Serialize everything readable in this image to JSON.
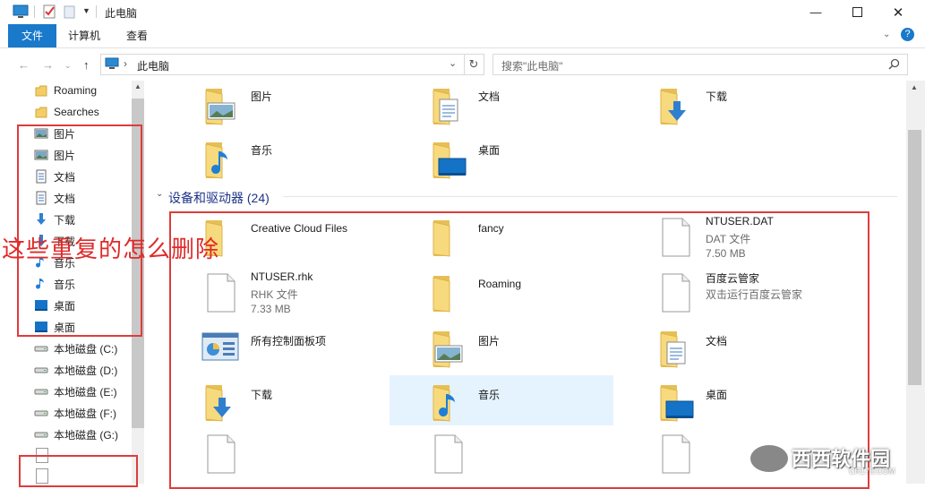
{
  "window": {
    "title": "此电脑"
  },
  "ribbon": {
    "tabs": [
      "文件",
      "计算机",
      "查看"
    ]
  },
  "address": {
    "path": "此电脑",
    "search_placeholder": "搜索\"此电脑\""
  },
  "sidebar": {
    "items": [
      {
        "label": "Roaming",
        "icon": "folder-icon"
      },
      {
        "label": "Searches",
        "icon": "folder-icon"
      },
      {
        "label": "图片",
        "icon": "pictures-icon"
      },
      {
        "label": "图片",
        "icon": "pictures-icon"
      },
      {
        "label": "文档",
        "icon": "documents-icon"
      },
      {
        "label": "文档",
        "icon": "documents-icon"
      },
      {
        "label": "下载",
        "icon": "downloads-icon"
      },
      {
        "label": "下载",
        "icon": "downloads-icon"
      },
      {
        "label": "音乐",
        "icon": "music-icon"
      },
      {
        "label": "音乐",
        "icon": "music-icon"
      },
      {
        "label": "桌面",
        "icon": "desktop-icon"
      },
      {
        "label": "桌面",
        "icon": "desktop-icon"
      },
      {
        "label": "本地磁盘 (C:)",
        "icon": "drive-icon"
      },
      {
        "label": "本地磁盘 (D:)",
        "icon": "drive-icon"
      },
      {
        "label": "本地磁盘 (E:)",
        "icon": "drive-icon"
      },
      {
        "label": "本地磁盘 (F:)",
        "icon": "drive-icon"
      },
      {
        "label": "本地磁盘 (G:)",
        "icon": "drive-icon"
      }
    ]
  },
  "folders_top": [
    {
      "name": "图片",
      "icon": "pictures-icon"
    },
    {
      "name": "文档",
      "icon": "documents-icon"
    },
    {
      "name": "下载",
      "icon": "downloads-icon"
    },
    {
      "name": "音乐",
      "icon": "music-icon"
    },
    {
      "name": "桌面",
      "icon": "desktop-icon"
    }
  ],
  "devices": {
    "header": "设备和驱动器 (24)",
    "items": [
      {
        "name": "Creative Cloud Files",
        "icon": "folder-icon"
      },
      {
        "name": "fancy",
        "icon": "folder-icon"
      },
      {
        "name": "NTUSER.DAT",
        "type": "DAT 文件",
        "size": "7.50 MB",
        "icon": "file-icon"
      },
      {
        "name": "NTUSER.rhk",
        "type": "RHK 文件",
        "size": "7.33 MB",
        "icon": "file-icon"
      },
      {
        "name": "Roaming",
        "icon": "folder-icon"
      },
      {
        "name": "百度云管家",
        "type": "双击运行百度云管家",
        "icon": "file-icon"
      },
      {
        "name": "所有控制面板项",
        "icon": "control-panel-icon"
      },
      {
        "name": "图片",
        "icon": "pictures-icon"
      },
      {
        "name": "文档",
        "icon": "documents-icon"
      },
      {
        "name": "下载",
        "icon": "downloads-icon"
      },
      {
        "name": "音乐",
        "icon": "music-icon",
        "selected": true
      },
      {
        "name": "桌面",
        "icon": "desktop-icon"
      }
    ]
  },
  "annotation": {
    "text": "这些重复的怎么删除"
  },
  "watermark": {
    "text": "西西软件园",
    "sub": "CR173.COM"
  }
}
